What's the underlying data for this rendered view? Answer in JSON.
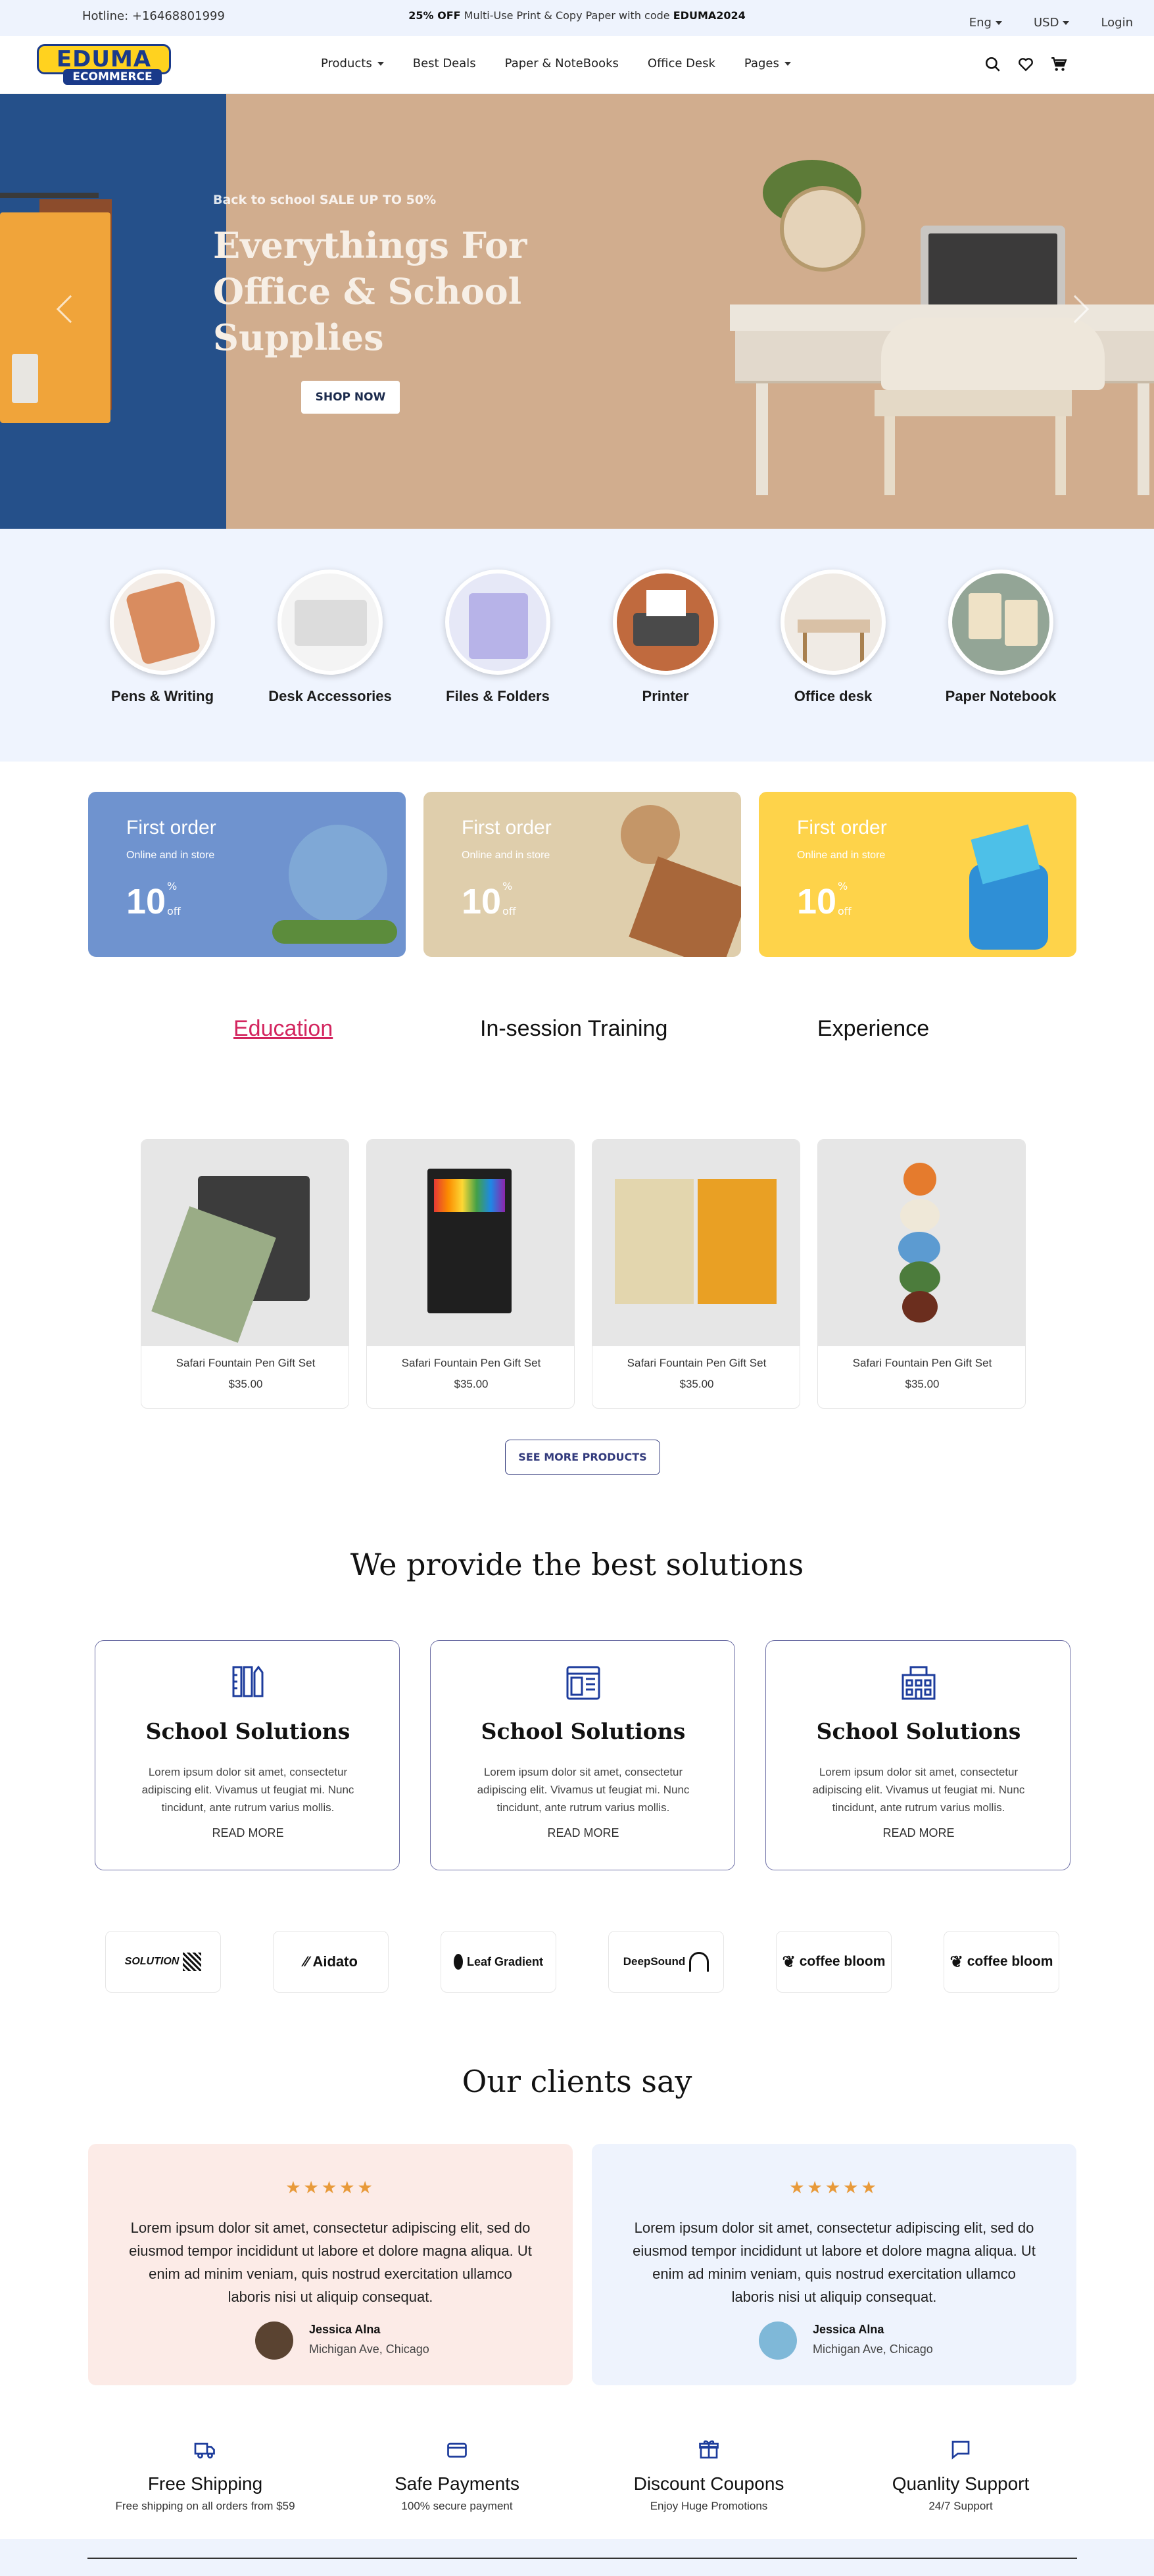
{
  "topbar": {
    "hotline": "Hotline: +16468801999",
    "promo_bold": "25% OFF",
    "promo_text": "Multi-Use Print & Copy Paper with code",
    "promo_code": "EDUMA2024",
    "language": "Eng",
    "currency": "USD",
    "login": "Login"
  },
  "nav": {
    "logo_top": "EDUMA",
    "logo_bottom": "ECOMMERCE",
    "items": [
      "Products",
      "Best Deals",
      "Paper & NoteBooks",
      "Office Desk",
      "Pages"
    ]
  },
  "hero": {
    "tagline": "Back to school SALE UP TO 50%",
    "title": "Everythings For Office & School Supplies",
    "button": "SHOP NOW"
  },
  "categories": [
    {
      "label": "Pens & Writing",
      "color": "#d98c5f"
    },
    {
      "label": "Desk Accessories",
      "color": "#dcdcdc"
    },
    {
      "label": "Files & Folders",
      "color": "#b7b3e8"
    },
    {
      "label": "Printer",
      "color": "#4a4a4a"
    },
    {
      "label": "Office desk",
      "color": "#d9c1a6"
    },
    {
      "label": "Paper Notebook",
      "color": "#93a596"
    }
  ],
  "promos": [
    {
      "title": "First order",
      "subtitle": "Online and in store",
      "value": "10",
      "pct": "%",
      "off": "off",
      "bg": "#6f93cf"
    },
    {
      "title": "First order",
      "subtitle": "Online and in store",
      "value": "10",
      "pct": "%",
      "off": "off",
      "bg": "#dfceac"
    },
    {
      "title": "First order",
      "subtitle": "Online and in store",
      "value": "10",
      "pct": "%",
      "off": "off",
      "bg": "#fed34a"
    }
  ],
  "tabs": [
    "Education",
    "In-session Training",
    "Experience"
  ],
  "products": [
    {
      "name": "Safari Fountain Pen Gift Set",
      "price": "$35.00"
    },
    {
      "name": "Safari Fountain Pen Gift Set",
      "price": "$35.00"
    },
    {
      "name": "Safari Fountain Pen Gift Set",
      "price": "$35.00"
    },
    {
      "name": "Safari Fountain Pen Gift Set",
      "price": "$35.00"
    }
  ],
  "see_more": "SEE MORE PRODUCTS",
  "solutions": {
    "title": "We provide the best solutions",
    "cards": [
      {
        "title": "School Solutions",
        "desc": "Lorem ipsum dolor sit amet, consectetur adipiscing elit. Vivamus ut feugiat mi. Nunc tincidunt, ante rutrum varius mollis.",
        "link": "READ MORE"
      },
      {
        "title": "School Solutions",
        "desc": "Lorem ipsum dolor sit amet, consectetur adipiscing elit. Vivamus ut feugiat mi. Nunc tincidunt, ante rutrum varius mollis.",
        "link": "READ MORE"
      },
      {
        "title": "School Solutions",
        "desc": "Lorem ipsum dolor sit amet, consectetur adipiscing elit. Vivamus ut feugiat mi. Nunc tincidunt, ante rutrum varius mollis.",
        "link": "READ MORE"
      }
    ]
  },
  "brands": [
    "SOLUTION",
    "Aidato",
    "Leaf Gradient",
    "DeepSound",
    "coffee bloom",
    "coffee bloom"
  ],
  "clients": {
    "title": "Our clients say",
    "stars": "★★★★★",
    "items": [
      {
        "quote": "Lorem ipsum dolor sit amet, consectetur adipiscing elit, sed do eiusmod tempor incididunt ut labore et dolore magna aliqua. Ut enim ad minim veniam, quis nostrud exercitation ullamco laboris nisi ut aliquip consequat.",
        "name": "Jessica Alna",
        "location": "Michigan Ave, Chicago",
        "bg": "#fcebe7"
      },
      {
        "quote": "Lorem ipsum dolor sit amet, consectetur adipiscing elit, sed do eiusmod tempor incididunt ut labore et dolore magna aliqua. Ut enim ad minim veniam, quis nostrud exercitation ullamco laboris nisi ut aliquip consequat.",
        "name": "Jessica Alna",
        "location": "Michigan Ave, Chicago",
        "bg": "#eef3fd"
      }
    ]
  },
  "features": [
    {
      "title": "Free Shipping",
      "desc": "Free shipping on all orders from $59",
      "icon": "truck-icon"
    },
    {
      "title": "Safe Payments",
      "desc": "100% secure payment",
      "icon": "credit-card-icon"
    },
    {
      "title": "Discount Coupons",
      "desc": "Enjoy Huge Promotions",
      "icon": "gift-icon"
    },
    {
      "title": "Quanlity Support",
      "desc": "24/7 Support",
      "icon": "chat-icon"
    }
  ]
}
